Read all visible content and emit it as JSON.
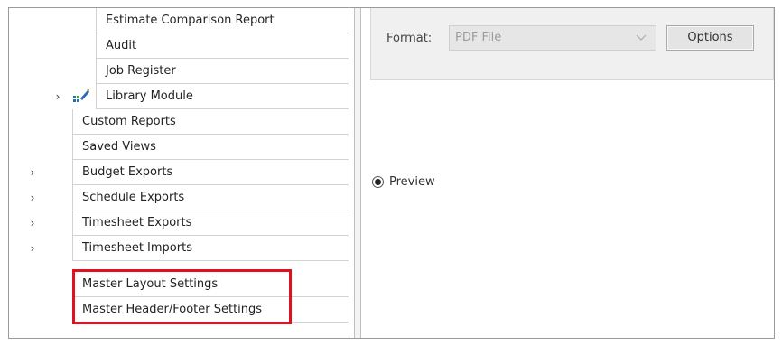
{
  "tree": {
    "items": [
      {
        "label": "Estimate Comparison Report",
        "level": "sub",
        "expandable": false
      },
      {
        "label": "Audit",
        "level": "sub",
        "expandable": false
      },
      {
        "label": "Job Register",
        "level": "sub",
        "expandable": false
      },
      {
        "label": "Library Module",
        "level": "sub",
        "expandable": true,
        "icon": "library-module-icon"
      },
      {
        "label": "Custom Reports",
        "level": "top",
        "expandable": false
      },
      {
        "label": "Saved Views",
        "level": "top",
        "expandable": false
      },
      {
        "label": "Budget Exports",
        "level": "top",
        "expandable": true
      },
      {
        "label": "Schedule Exports",
        "level": "top",
        "expandable": true
      },
      {
        "label": "Timesheet Exports",
        "level": "top",
        "expandable": true
      },
      {
        "label": "Timesheet Imports",
        "level": "top",
        "expandable": true
      },
      {
        "label": "Master Layout Settings",
        "level": "top",
        "expandable": false
      },
      {
        "label": "Master Header/Footer Settings",
        "level": "top",
        "expandable": false
      }
    ],
    "expand_glyph": "›"
  },
  "options": {
    "format_label": "Format:",
    "format_value": "PDF File",
    "options_button": "Options"
  },
  "preview": {
    "label": "Preview",
    "selected": true
  },
  "colors": {
    "highlight": "#e0101c",
    "panel_bg": "#f0f0f0"
  }
}
